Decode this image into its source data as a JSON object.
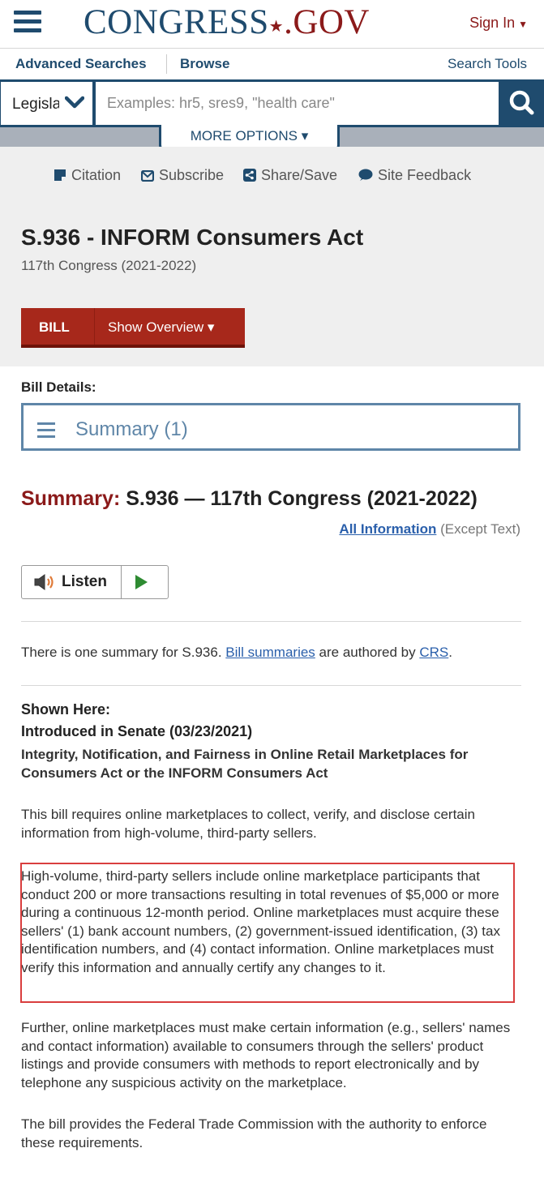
{
  "header": {
    "logo_main": "CONGRESS",
    "logo_dot": "★",
    "logo_tld": ".GOV",
    "signin_label": "Sign In",
    "signin_caret": "▼"
  },
  "subnav": {
    "advanced": "Advanced Searches",
    "browse": "Browse",
    "tools": "Search Tools"
  },
  "search": {
    "scope": "Legislation",
    "placeholder": "Examples: hr5, sres9, \"health care\"",
    "more_options": "MORE OPTIONS ▾"
  },
  "tools": {
    "citation": "Citation",
    "subscribe": "Subscribe",
    "share": "Share/Save",
    "feedback": "Site Feedback"
  },
  "bill": {
    "title": "S.936 - INFORM Consumers Act",
    "congress": "117th Congress (2021-2022)",
    "tab_bill": "BILL",
    "tab_overview": "Show Overview ▾"
  },
  "details": {
    "label": "Bill Details:",
    "selected": "Summary (1)"
  },
  "summary": {
    "heading_prefix": "Summary:",
    "heading_rest": " S.936 — 117th Congress (2021-2022)",
    "all_info_link": "All Information",
    "all_info_suffix": " (Except Text)",
    "listen_label": "Listen",
    "intro_1": "There is one summary for S.936. ",
    "intro_link1": "Bill summaries",
    "intro_2": " are authored by ",
    "intro_link2": "CRS",
    "intro_3": ".",
    "shown_here": "Shown Here:",
    "introduced": "Introduced in Senate (03/23/2021)",
    "long_title": "Integrity, Notification, and Fairness in Online Retail Marketplaces for Consumers Act or the INFORM Consumers Act",
    "p1": "This bill requires online marketplaces to collect, verify, and disclose certain information from high-volume, third-party sellers.",
    "p2": "High-volume, third-party sellers include online marketplace participants that conduct 200 or more transactions resulting in total revenues of $5,000 or more during a continuous 12-month period. Online marketplaces must acquire these sellers' (1) bank account numbers, (2) government-issued identification, (3) tax identification numbers, and (4) contact information. Online marketplaces must verify this information and annually certify any changes to it.",
    "p3": "Further, online marketplaces must make certain information (e.g., sellers' names and contact information) available to consumers through the sellers' product listings and provide consumers with methods to report electronically and by telephone any suspicious activity on the marketplace.",
    "p4": "The bill provides the Federal Trade Commission with the authority to enforce these requirements."
  },
  "colors": {
    "brand_blue": "#1f4b6e",
    "brand_red": "#8b1a1a",
    "highlight_red": "#d93e3e"
  }
}
